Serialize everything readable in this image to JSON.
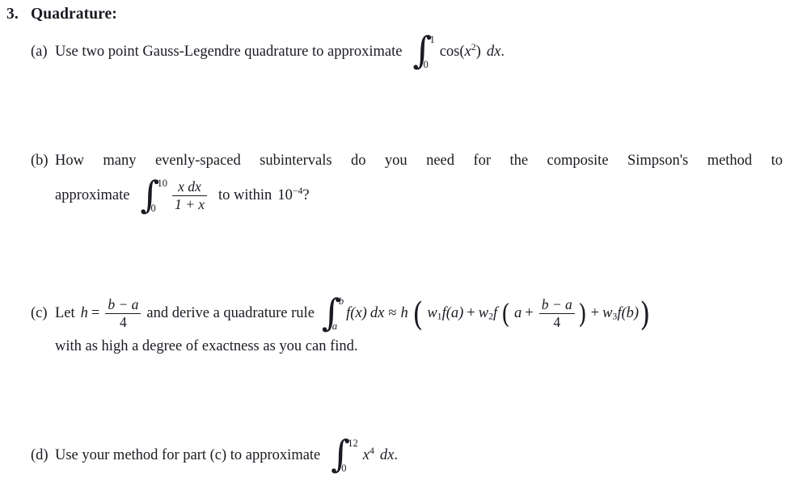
{
  "document": {
    "type": "homework-problem",
    "background_color": "#ffffff",
    "text_color": "#1a1a22"
  },
  "problem": {
    "number": "3.",
    "title": "Quadrature:"
  },
  "parts": [
    {
      "label": "(a)",
      "text_before": "Use two point Gauss-Legendre quadrature to approximate",
      "math": {
        "integral": {
          "lower": "0",
          "upper": "1",
          "integrand": "cos(x²)",
          "differential": "dx"
        },
        "trailing": "."
      },
      "plain": "Use two point Gauss-Legendre quadrature to approximate ∫₀¹ cos(x²) dx."
    },
    {
      "label": "(b)",
      "line1_words": [
        "How",
        "many",
        "evenly-spaced",
        "subintervals",
        "do",
        "you",
        "need",
        "for",
        "the",
        "composite",
        "Simpson's",
        "method",
        "to"
      ],
      "line2_before": "approximate",
      "math": {
        "integral": {
          "lower": "0",
          "upper": "10",
          "numerator": "x  dx",
          "denominator": "1 + x"
        }
      },
      "line2_middle": "to within",
      "tolerance": {
        "base": "10",
        "exponent": "−4"
      },
      "line2_after": "?",
      "plain": "How many evenly-spaced subintervals do you need for the composite Simpson's method to approximate ∫₀¹⁰ x dx/(1+x) to within 10⁻⁴?"
    },
    {
      "label": "(c)",
      "line1_before": "Let",
      "h_symbol": "h",
      "equals": "=",
      "h_fraction": {
        "numerator": "b − a",
        "denominator": "4"
      },
      "line1_middle": "and derive a quadrature rule",
      "rule": {
        "integral": {
          "lower": "a",
          "upper": "b",
          "integrand": "f(x)",
          "differential": "dx"
        },
        "approx_symbol": "≈",
        "h": "h",
        "open_paren": "(",
        "term1": {
          "weight": "w",
          "weight_index": "1",
          "func": "f(a)"
        },
        "plus1": "+",
        "term2": {
          "weight": "w",
          "weight_index": "2",
          "func_head": "f",
          "inner_open": "(",
          "inner_arg_a": "a",
          "inner_plus": "+",
          "inner_fraction": {
            "numerator": "b − a",
            "denominator": "4"
          },
          "inner_close": ")"
        },
        "plus2": "+",
        "term3": {
          "weight": "w",
          "weight_index": "3",
          "func": "f(b)"
        },
        "close_paren": ")"
      },
      "line2": "with as high a degree of exactness as you can find.",
      "plain": "Let h = (b−a)/4 and derive a quadrature rule ∫ₐᵇ f(x) dx ≈ h ( w₁f(a) + w₂f(a + (b−a)/4) + w₃f(b) ) with as high a degree of exactness as you can find."
    },
    {
      "label": "(d)",
      "text_before": "Use your method for part (c) to approximate",
      "math": {
        "integral": {
          "lower": "0",
          "upper": "12",
          "integrand": "x",
          "integrand_exponent": "4",
          "differential": "dx"
        },
        "trailing": "."
      },
      "plain": "Use your method for part (c) to approximate ∫₀¹² x⁴ dx."
    }
  ]
}
